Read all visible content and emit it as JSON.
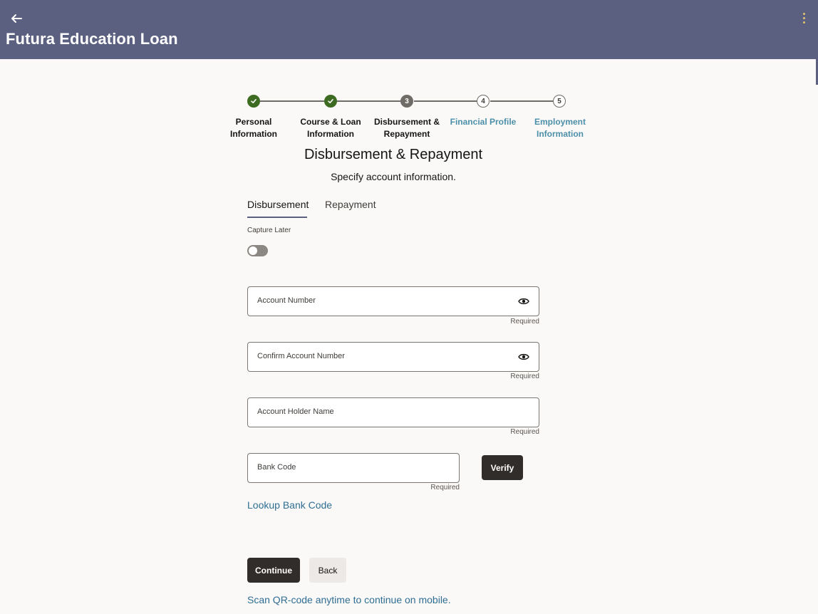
{
  "header": {
    "title": "Futura Education Loan",
    "back_icon": "arrow-left-icon",
    "menu_icon": "kebab-menu-icon"
  },
  "stepper": {
    "steps": [
      {
        "number": "1",
        "label_line1": "Personal",
        "label_line2": "Information",
        "status": "complete"
      },
      {
        "number": "2",
        "label_line1": "Course & Loan",
        "label_line2": "Information",
        "status": "complete"
      },
      {
        "number": "3",
        "label_line1": "Disbursement &",
        "label_line2": "Repayment",
        "status": "current"
      },
      {
        "number": "4",
        "label_line1": "Financial Profile",
        "label_line2": "",
        "status": "upcoming"
      },
      {
        "number": "5",
        "label_line1": "Employment",
        "label_line2": "Information",
        "status": "upcoming"
      }
    ]
  },
  "page": {
    "title": "Disbursement & Repayment",
    "subtitle": "Specify account information."
  },
  "tabs": {
    "disbursement": "Disbursement",
    "repayment": "Repayment",
    "active": "Disbursement"
  },
  "capture_later": {
    "label": "Capture Later",
    "enabled": false
  },
  "form": {
    "account_number": {
      "label": "Account Number",
      "value": "",
      "hint": "Required"
    },
    "confirm_account_number": {
      "label": "Confirm Account Number",
      "value": "",
      "hint": "Required"
    },
    "account_holder_name": {
      "label": "Account Holder Name",
      "value": "",
      "hint": "Required"
    },
    "bank_code": {
      "label": "Bank Code",
      "value": "",
      "hint": "Required"
    },
    "verify_label": "Verify",
    "lookup_link": "Lookup Bank Code"
  },
  "actions": {
    "continue_label": "Continue",
    "back_label": "Back",
    "qr_link": "Scan QR-code anytime to continue on mobile."
  },
  "colors": {
    "header_bg": "#5b6080",
    "primary_button": "#312d2a",
    "step_complete": "#3d6b22",
    "link": "#2f6e93",
    "upcoming_step_label": "#4c8fa8"
  }
}
